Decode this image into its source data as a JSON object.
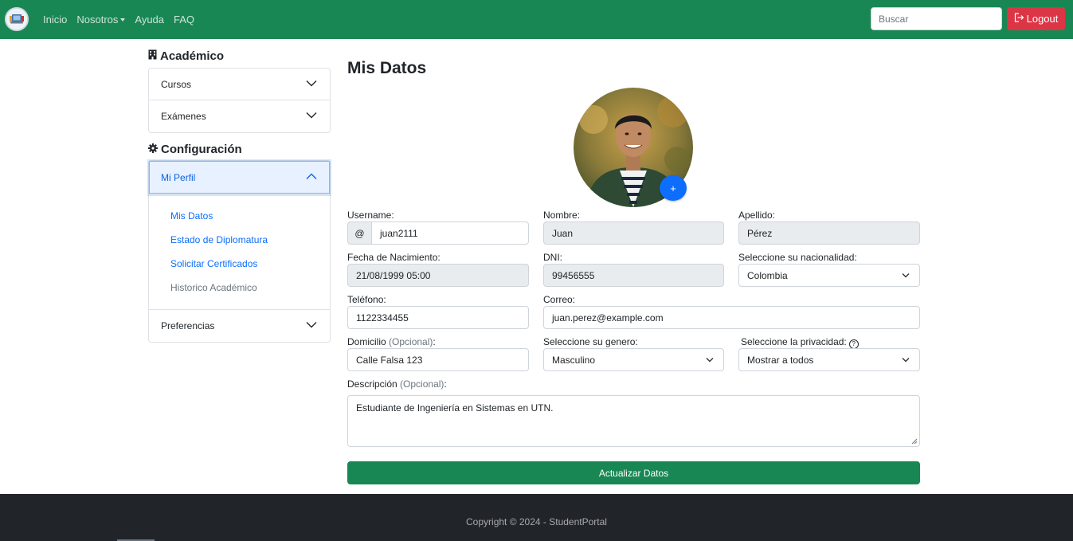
{
  "navbar": {
    "links": [
      {
        "label": "Inicio"
      },
      {
        "label": "Nosotros",
        "dropdown": true
      },
      {
        "label": "Ayuda"
      },
      {
        "label": "FAQ"
      }
    ],
    "search_placeholder": "Buscar",
    "logout_label": "Logout",
    "accent_color": "#198754"
  },
  "sidebar": {
    "academic": {
      "heading": "Académico",
      "icon": "building-icon",
      "items": [
        {
          "label": "Cursos"
        },
        {
          "label": "Exámenes"
        }
      ]
    },
    "config": {
      "heading": "Configuración",
      "icon": "gear-icon",
      "open_item": "Mi Perfil",
      "sub_links": [
        {
          "label": "Mis Datos"
        },
        {
          "label": "Estado de Diplomatura"
        },
        {
          "label": "Solicitar Certificados"
        },
        {
          "label": "Historico Académico"
        }
      ],
      "closed_item": "Preferencias"
    }
  },
  "main": {
    "title": "Mis Datos",
    "avatar_add_label": "+",
    "form": {
      "username": {
        "label": "Username:",
        "prefix": "@",
        "value": "juan2111"
      },
      "nombre": {
        "label": "Nombre:",
        "value": "Juan"
      },
      "apellido": {
        "label": "Apellido:",
        "value": "Pérez"
      },
      "fecha": {
        "label": "Fecha de Nacimiento:",
        "value": "21/08/1999 05:00"
      },
      "dni": {
        "label": "DNI:",
        "value": "99456555"
      },
      "nacionalidad": {
        "label": "Seleccione su nacionalidad:",
        "value": "Colombia"
      },
      "telefono": {
        "label": "Teléfono:",
        "value": "1122334455"
      },
      "correo": {
        "label": "Correo:",
        "value": "juan.perez@example.com"
      },
      "domicilio": {
        "label": "Domicilio",
        "optional": "(Opcional)",
        "suffix": ":",
        "value": "Calle Falsa 123"
      },
      "genero": {
        "label": "Seleccione su genero:",
        "value": "Masculino"
      },
      "privacidad": {
        "label": "Seleccione la privacidad:",
        "help": "?",
        "value": "Mostrar a todos"
      },
      "descripcion": {
        "label": "Descripción",
        "optional": "(Opcional)",
        "suffix": ":",
        "value": "Estudiante de Ingeniería en Sistemas en UTN."
      }
    },
    "submit_label": "Actualizar Datos"
  },
  "footer": {
    "copyright": "Copyright © 2024 - StudentPortal"
  }
}
